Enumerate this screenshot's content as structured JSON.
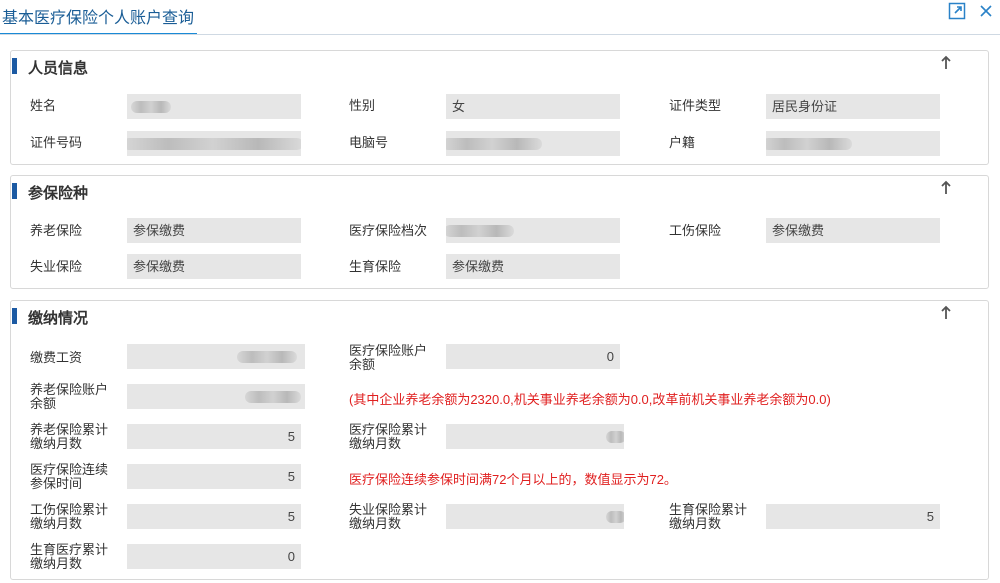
{
  "window": {
    "title": "基本医疗保险个人账户查询"
  },
  "personal": {
    "header": "人员信息",
    "name_label": "姓名",
    "gender_label": "性别",
    "gender_value": "女",
    "id_type_label": "证件类型",
    "id_type_value": "居民身份证",
    "id_number_label": "证件号码",
    "computer_no_label": "电脑号",
    "household_label": "户籍"
  },
  "insurance": {
    "header": "参保险种",
    "pension_label": "养老保险",
    "pension_value": "参保缴费",
    "medical_file_label": "医疗保险档次",
    "injury_label": "工伤保险",
    "injury_value": "参保缴费",
    "unemployment_label": "失业保险",
    "unemployment_value": "参保缴费",
    "maternity_label": "生育保险",
    "maternity_value": "参保缴费"
  },
  "payment": {
    "header": "缴纳情况",
    "wage_label": "缴费工资",
    "medical_balance_label": "医疗保险账户余额",
    "medical_balance_value": "0",
    "pension_balance_label": "养老保险账户余额",
    "pension_note": "(其中企业养老余额为2320.0,机关事业养老余额为0.0,改革前机关事业养老余额为0.0)",
    "pension_months_label": "养老保险累计缴纳月数",
    "pension_months_value": "5",
    "medical_months_label": "医疗保险累计缴纳月数",
    "medical_cont_label": "医疗保险连续参保时间",
    "medical_cont_value": "5",
    "medical_cont_note": "医疗保险连续参保时间满72个月以上的，数值显示为72。",
    "injury_months_label": "工伤保险累计缴纳月数",
    "injury_months_value": "5",
    "unemp_months_label": "失业保险累计缴纳月数",
    "maternity_months_label": "生育保险累计缴纳月数",
    "maternity_months_value": "5",
    "maternity_med_label": "生育医疗累计缴纳月数",
    "maternity_med_value": "0"
  }
}
